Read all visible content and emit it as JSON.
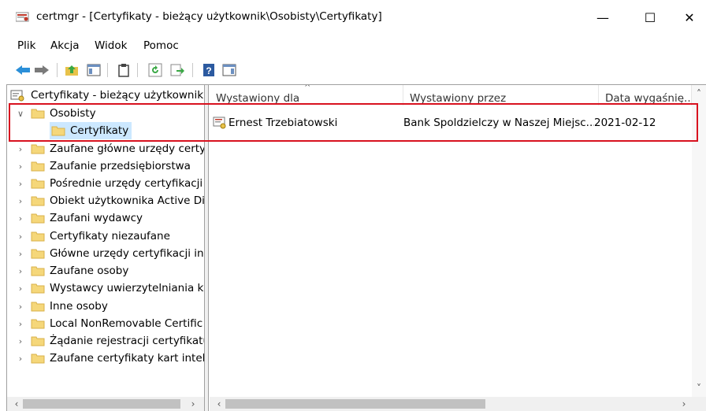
{
  "window": {
    "title": "certmgr - [Certyfikaty - bieżący użytkownik\\Osobisty\\Certyfikaty]",
    "minimize": "—",
    "maximize": "☐",
    "close": "✕"
  },
  "menu": [
    "Plik",
    "Akcja",
    "Widok",
    "Pomoc"
  ],
  "tree": {
    "root": "Certyfikaty - bieżący użytkownik",
    "items": [
      {
        "label": "Osobisty",
        "expanded": true
      },
      {
        "label": "Certyfikaty",
        "selected": true
      },
      {
        "label": "Zaufane główne urzędy certy"
      },
      {
        "label": "Zaufanie przedsiębiorstwa"
      },
      {
        "label": "Pośrednie urzędy certyfikacji"
      },
      {
        "label": "Obiekt użytkownika Active Di"
      },
      {
        "label": "Zaufani wydawcy"
      },
      {
        "label": "Certyfikaty niezaufane"
      },
      {
        "label": "Główne urzędy certyfikacji in"
      },
      {
        "label": "Zaufane osoby"
      },
      {
        "label": "Wystawcy uwierzytelniania kl"
      },
      {
        "label": "Inne osoby"
      },
      {
        "label": "Local NonRemovable Certific"
      },
      {
        "label": "Żądanie rejestracji certyfikatu"
      },
      {
        "label": "Zaufane certyfikaty kart inteli"
      }
    ]
  },
  "list": {
    "columns": [
      "Wystawiony dla",
      "Wystawiony przez",
      "Data wygaśnię..."
    ],
    "rows": [
      {
        "issued_to": "Ernest Trzebiatowski",
        "issued_by": "Bank Spoldzielczy w Naszej Miejsc...",
        "expires": "2021-02-12"
      }
    ]
  },
  "colors": {
    "highlight": "#d8121f",
    "selection": "#cce8ff",
    "folder": "#f5d77a"
  }
}
